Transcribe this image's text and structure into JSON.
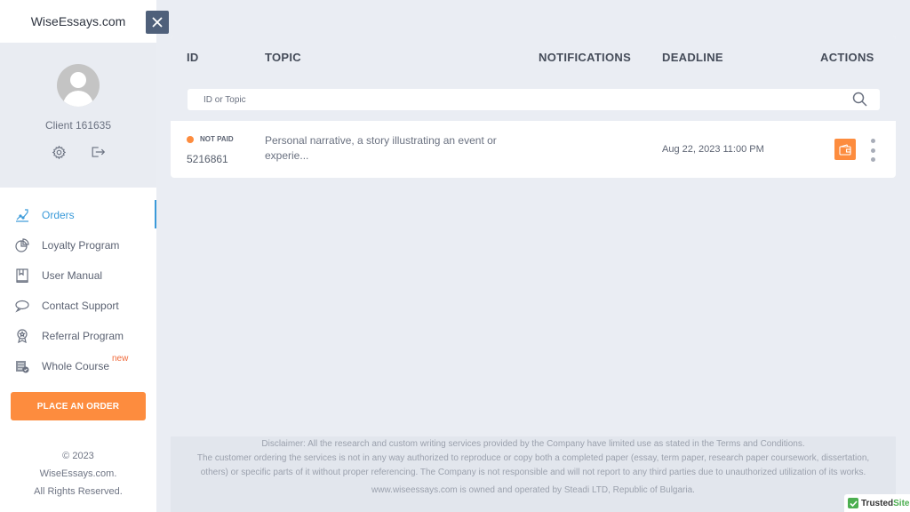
{
  "sidebar": {
    "brand": "WiseEssays.com",
    "client_name": "Client 161635",
    "nav": [
      {
        "label": "Orders",
        "icon": "orders-chart-icon",
        "active": true
      },
      {
        "label": "Loyalty Program",
        "icon": "pie-chart-icon"
      },
      {
        "label": "User Manual",
        "icon": "book-icon"
      },
      {
        "label": "Contact Support",
        "icon": "chat-bubble-icon"
      },
      {
        "label": "Referral Program",
        "icon": "award-ribbon-icon"
      },
      {
        "label": "Whole Course",
        "icon": "course-calendar-icon",
        "badge": "new"
      }
    ],
    "place_order_label": "PLACE AN ORDER",
    "copyright": [
      "© 2023",
      "WiseEssays.com.",
      "All Rights Reserved."
    ]
  },
  "colors": {
    "accent": "#3a9ad9",
    "orange": "#fd8c3e",
    "close_bg": "#4f607a",
    "new_badge": "#f06a3b"
  },
  "table": {
    "headers": {
      "id": "ID",
      "topic": "TOPIC",
      "notifications": "NOTIFICATIONS",
      "deadline": "DEADLINE",
      "actions": "ACTIONS"
    },
    "search_placeholder": "ID or Topic",
    "rows": [
      {
        "status": "NOT PAID",
        "id": "5216861",
        "topic": "Personal narrative, a story illustrating an event or experie...",
        "notifications": "",
        "deadline": "Aug 22, 2023 11:00 PM"
      }
    ]
  },
  "footer": {
    "line1": "Disclaimer: All the research and custom writing services provided by the Company have limited use as stated in the Terms and Conditions.",
    "line2": "The customer ordering the services is not in any way authorized to reproduce or copy both a completed paper (essay, term paper, research paper coursework, dissertation,",
    "line3": "others) or specific parts of it without proper referencing. The Company is not responsible and will not report to any third parties due to unauthorized utilization of its works.",
    "owned": "www.wiseessays.com is owned and operated by Steadi LTD, Republic of Bulgaria."
  },
  "trusted_badge": {
    "part1": "Trusted",
    "part2": "Site"
  }
}
